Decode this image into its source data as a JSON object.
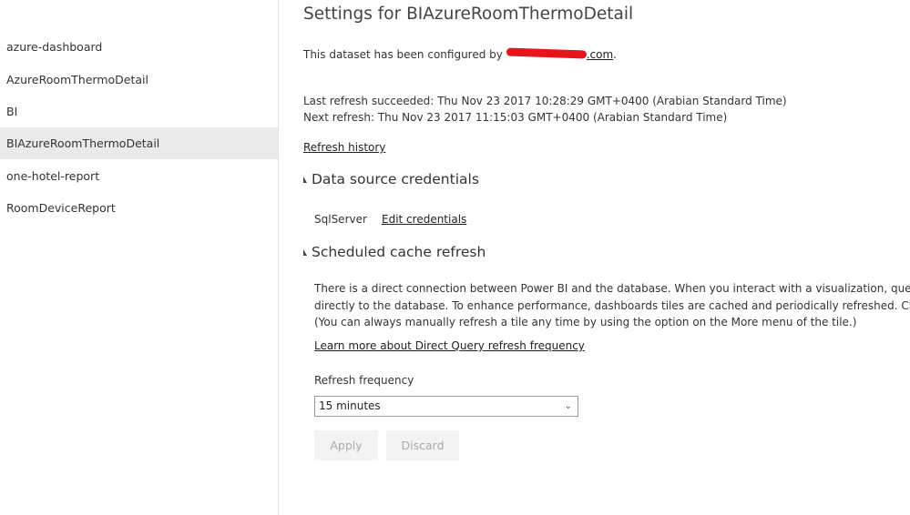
{
  "sidebar": {
    "items": [
      {
        "label": "azure-dashboard"
      },
      {
        "label": "AzureRoomThermoDetail"
      },
      {
        "label": "BI"
      },
      {
        "label": "BIAzureRoomThermoDetail",
        "selected": true
      },
      {
        "label": "one-hotel-report"
      },
      {
        "label": "RoomDeviceReport"
      }
    ]
  },
  "main": {
    "title": "Settings for BIAzureRoomThermoDetail",
    "configured_prefix": "This dataset has been configured by ",
    "configured_email_suffix": "com",
    "configured_end": ".",
    "last_refresh": "Last refresh succeeded: Thu Nov 23 2017 10:28:29 GMT+0400 (Arabian Standard Time)",
    "next_refresh": "Next refresh: Thu Nov 23 2017 11:15:03 GMT+0400 (Arabian Standard Time)",
    "refresh_history": "Refresh history",
    "credentials": {
      "heading": "Data source credentials",
      "source": "SqlServer",
      "edit": "Edit credentials"
    },
    "cache": {
      "heading": "Scheduled cache refresh",
      "line1": "There is a direct connection between Power BI and the database. When you interact with a visualization, queries are",
      "line2": "directly to the database. To enhance performance, dashboards tiles are cached and periodically refreshed. Change t",
      "line3": "(You can always manually refresh a tile any time by using the option on the More menu of the tile.)",
      "learn_more": "Learn more about Direct Query refresh frequency",
      "freq_label": "Refresh frequency",
      "freq_value": "15 minutes",
      "apply": "Apply",
      "discard": "Discard"
    }
  },
  "colors": {
    "selected_bg": "#eaeaea",
    "redaction": "#e8141c"
  }
}
